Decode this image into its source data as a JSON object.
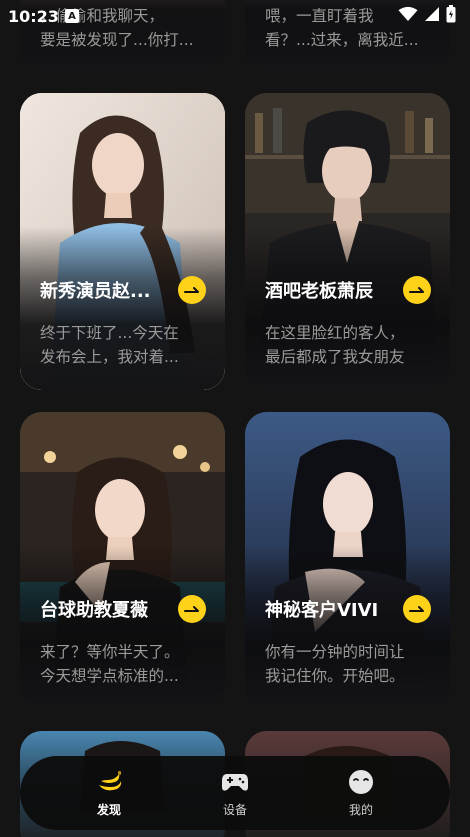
{
  "status_bar": {
    "time": "10:23",
    "notification_letter": "A"
  },
  "colors": {
    "background": "#141414",
    "accent": "#ffd21a",
    "desc_text": "#9a9a9a"
  },
  "top_cards": [
    {
      "desc_lines": [
        "，偷偷和我聊天，",
        "要是被发现了...你打..."
      ]
    },
    {
      "desc_lines": [
        "喂，一直盯着我",
        "看？...过来，离我近..."
      ]
    }
  ],
  "cards": [
    {
      "title": "新秀演员赵...",
      "desc_lines": [
        "终于下班了...今天在",
        "发布会上，我对着..."
      ],
      "icon": "arrow-right-icon"
    },
    {
      "title": "酒吧老板萧辰",
      "desc_lines": [
        "在这里脸红的客人，",
        "最后都成了我女朋友"
      ],
      "icon": "arrow-right-icon"
    },
    {
      "title": "台球助教夏薇",
      "desc_lines": [
        "来了？等你半天了。",
        "今天想学点标准的..."
      ],
      "icon": "arrow-right-icon"
    },
    {
      "title": "神秘客户VIVI",
      "desc_lines": [
        "你有一分钟的时间让",
        "我记住你。开始吧。"
      ],
      "icon": "arrow-right-icon"
    }
  ],
  "tab_bar": {
    "tabs": [
      {
        "label": "发现",
        "icon": "banana-icon",
        "active": true
      },
      {
        "label": "设备",
        "icon": "gamepad-icon",
        "active": false
      },
      {
        "label": "我的",
        "icon": "face-icon",
        "active": false
      }
    ]
  }
}
